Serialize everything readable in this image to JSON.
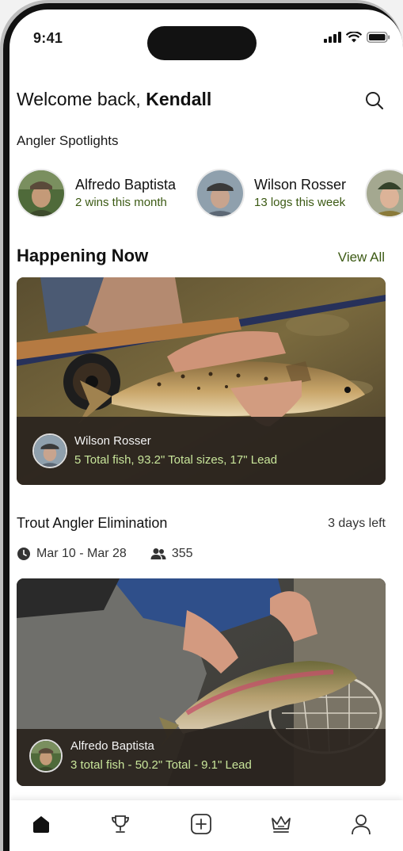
{
  "status": {
    "time": "9:41"
  },
  "header": {
    "greeting": "Welcome back,",
    "user": "Kendall"
  },
  "spotlights": {
    "title": "Angler Spotlights",
    "items": [
      {
        "name": "Alfredo Baptista",
        "sub": "2 wins this month"
      },
      {
        "name": "Wilson Rosser",
        "sub": "13 logs this week"
      },
      {
        "name": "",
        "sub": ""
      }
    ]
  },
  "happening": {
    "title": "Happening Now",
    "view_all": "View All"
  },
  "cards": [
    {
      "name": "Wilson Rosser",
      "stats": "5 Total fish, 93.2\" Total sizes, 17\" Lead"
    },
    {
      "name": "Alfredo Baptista",
      "stats": "3 total fish - 50.2\" Total - 9.1\" Lead"
    }
  ],
  "event": {
    "title": "Trout Angler Elimination",
    "time_left": "3 days left",
    "dates": "Mar 10 - Mar 28",
    "participants": "355"
  },
  "tabs": [
    "home-icon",
    "trophy-icon",
    "add-icon",
    "crown-icon",
    "profile-icon"
  ],
  "colors": {
    "accent_green": "#3c5a14",
    "stats_green": "#c8e59a",
    "card_bar": "#2a241e"
  }
}
